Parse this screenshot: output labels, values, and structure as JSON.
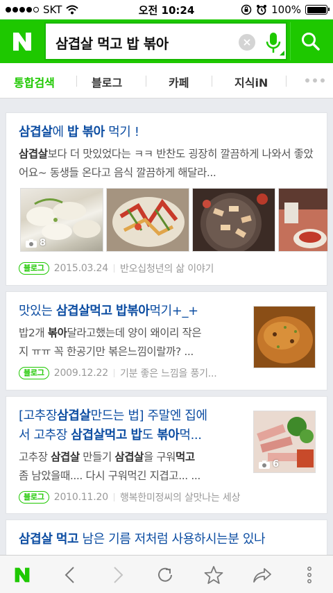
{
  "status_bar": {
    "carrier": "SKT",
    "time": "오전 10:24",
    "battery": "100%",
    "battery_level": 1.0
  },
  "search": {
    "logo": "N",
    "query": "삼겹살 먹고 밥 볶아"
  },
  "tabs": [
    {
      "label": "통합검색",
      "active": true
    },
    {
      "label": "블로그",
      "active": false
    },
    {
      "label": "카페",
      "active": false
    },
    {
      "label": "지식iN",
      "active": false
    }
  ],
  "results": [
    {
      "title_parts": [
        {
          "t": "삼겹살",
          "b": true
        },
        {
          "t": "에 ",
          "b": false
        },
        {
          "t": "밥",
          "b": true
        },
        {
          "t": " ",
          "b": false
        },
        {
          "t": "볶아",
          "b": true
        },
        {
          "t": " 먹기 !",
          "b": false
        }
      ],
      "desc_parts": [
        {
          "t": "삼겹살",
          "b": true
        },
        {
          "t": "보다 더 맛있었다는 ㅋㅋ 반찬도 굉장히 깔끔하게 나와서 좋았어요~ 동생들 온다고 음식 깔끔하게 해달라...",
          "b": false
        }
      ],
      "photo_count": "8",
      "badge": "블로그",
      "date": "2015.03.24",
      "source": "반오십청년의 삶 이야기"
    },
    {
      "title_parts": [
        {
          "t": "맛있는 ",
          "b": false
        },
        {
          "t": "삼겹살먹고",
          "b": true
        },
        {
          "t": " ",
          "b": false
        },
        {
          "t": "밥볶아",
          "b": true
        },
        {
          "t": "먹기+_+",
          "b": false
        }
      ],
      "desc_line1_parts": [
        {
          "t": "밥2개 ",
          "b": false
        },
        {
          "t": "볶아",
          "b": true
        },
        {
          "t": "달라고했는데 양이 왜이리 작은",
          "b": false
        }
      ],
      "desc_line2": "지 ㅠㅠ 꼭 한공기만 볶은느낌이랄까? ...",
      "badge": "블로그",
      "date": "2009.12.22",
      "source": "기분 좋은 느낌을 풍기..."
    },
    {
      "title_line1_parts": [
        {
          "t": "[고추장",
          "b": false
        },
        {
          "t": "삼겹살",
          "b": true
        },
        {
          "t": "만드는 법] 주말엔 집에",
          "b": false
        }
      ],
      "title_line2_parts": [
        {
          "t": "서 고추장 ",
          "b": false
        },
        {
          "t": "삼겹살먹고",
          "b": true
        },
        {
          "t": " ",
          "b": false
        },
        {
          "t": "밥",
          "b": true
        },
        {
          "t": "도 ",
          "b": false
        },
        {
          "t": "볶아",
          "b": true
        },
        {
          "t": "먹...",
          "b": false
        }
      ],
      "desc_line1_parts": [
        {
          "t": "고추장 ",
          "b": false
        },
        {
          "t": "삼겹살",
          "b": true
        },
        {
          "t": " 만들기 ",
          "b": false
        },
        {
          "t": "삼겹살",
          "b": true
        },
        {
          "t": "을 구워",
          "b": false
        },
        {
          "t": "먹고",
          "b": true
        }
      ],
      "desc_line2": "좀 남았을때.... 다시 구워먹긴 지겹고... ...",
      "photo_count": "6",
      "badge": "블로그",
      "date": "2010.11.20",
      "source": "행복한미정씨의 살맛나는 세상"
    },
    {
      "title_parts": [
        {
          "t": "삼겹살",
          "b": true
        },
        {
          "t": " ",
          "b": false
        },
        {
          "t": "먹고",
          "b": true
        },
        {
          "t": " 남은 기름 저처럼 사용하시는분 있나",
          "b": false
        }
      ]
    }
  ],
  "bottom_bar": {
    "logo": "N",
    "icons": [
      "back-icon",
      "forward-icon",
      "refresh-icon",
      "bookmark-star-icon",
      "share-icon",
      "more-vertical-icon"
    ]
  },
  "colors": {
    "brand_green": "#1ec800",
    "title_blue": "#0c4da2"
  }
}
